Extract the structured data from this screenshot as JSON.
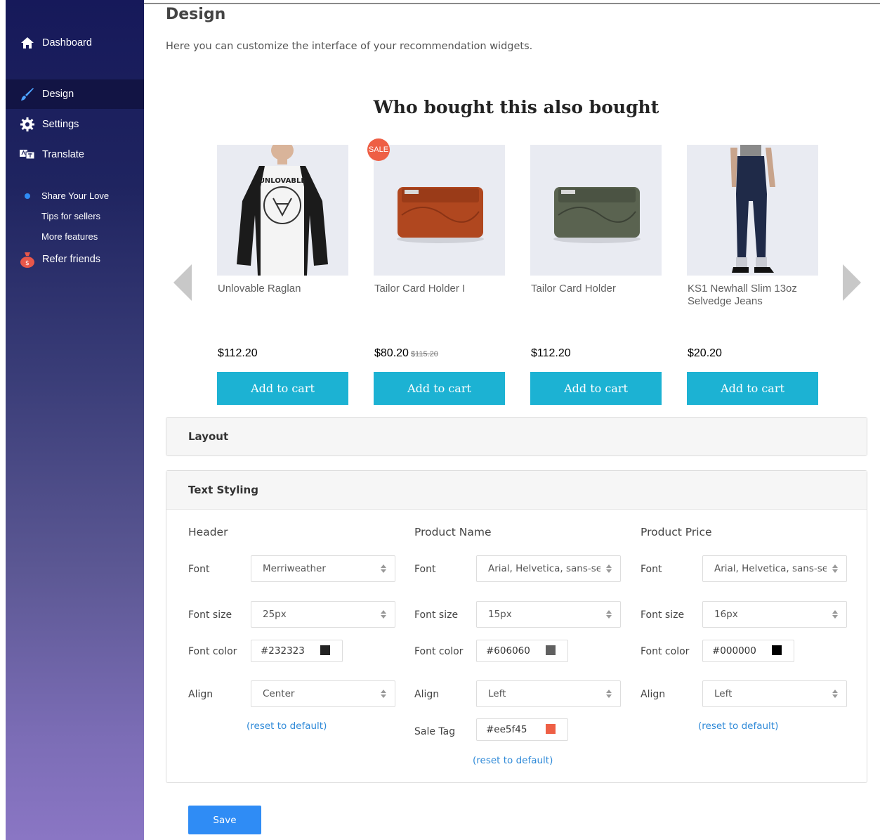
{
  "sidebar": {
    "items": [
      {
        "label": "Dashboard",
        "icon": "home-icon"
      },
      {
        "label": "Design",
        "icon": "brush-icon"
      },
      {
        "label": "Settings",
        "icon": "gear-icon"
      },
      {
        "label": "Translate",
        "icon": "translate-icon"
      }
    ],
    "sub_items": [
      "Share Your Love",
      "Tips for sellers",
      "More features"
    ],
    "refer": {
      "label": "Refer friends",
      "icon": "money-bag-icon"
    }
  },
  "page": {
    "title": "Design",
    "description": "Here you can customize the interface of your recommendation widgets."
  },
  "widget": {
    "title": "Who bought this also bought",
    "sale_badge": "SALE",
    "products": [
      {
        "name": "Unlovable Raglan",
        "price": "$112.20",
        "old_price": "",
        "button": "Add to cart",
        "image": "raglan-shirt-image",
        "shirt_text": "UNLOVABLE"
      },
      {
        "name": "Tailor Card Holder I",
        "price": "$80.20",
        "old_price": "$115.20",
        "button": "Add to cart",
        "image": "brown-card-holder-image"
      },
      {
        "name": "Tailor Card Holder",
        "price": "$112.20",
        "old_price": "",
        "button": "Add to cart",
        "image": "green-card-holder-image"
      },
      {
        "name": "KS1 Newhall Slim 13oz Selvedge Jeans",
        "price": "$20.20",
        "old_price": "",
        "button": "Add to cart",
        "image": "jeans-image"
      }
    ]
  },
  "layout_panel": {
    "title": "Layout"
  },
  "text_styling": {
    "title": "Text Styling",
    "labels": {
      "font": "Font",
      "font_size": "Font size",
      "font_color": "Font color",
      "align": "Align",
      "sale_tag": "Sale Tag"
    },
    "reset": "(reset to default)",
    "header": {
      "title": "Header",
      "font": "Merriweather",
      "font_size": "25px",
      "font_color": "#232323",
      "align": "Center"
    },
    "product_name": {
      "title": "Product Name",
      "font": "Arial, Helvetica, sans-serif",
      "font_size": "15px",
      "font_color": "#606060",
      "align": "Left",
      "sale_tag": "#ee5f45"
    },
    "product_price": {
      "title": "Product Price",
      "font": "Arial, Helvetica, sans-serif",
      "font_size": "16px",
      "font_color": "#000000",
      "align": "Left"
    }
  },
  "save_label": "Save",
  "colors": {
    "accent": "#1cb2d3",
    "save": "#2f8cf5",
    "sale": "#ee5f45"
  }
}
